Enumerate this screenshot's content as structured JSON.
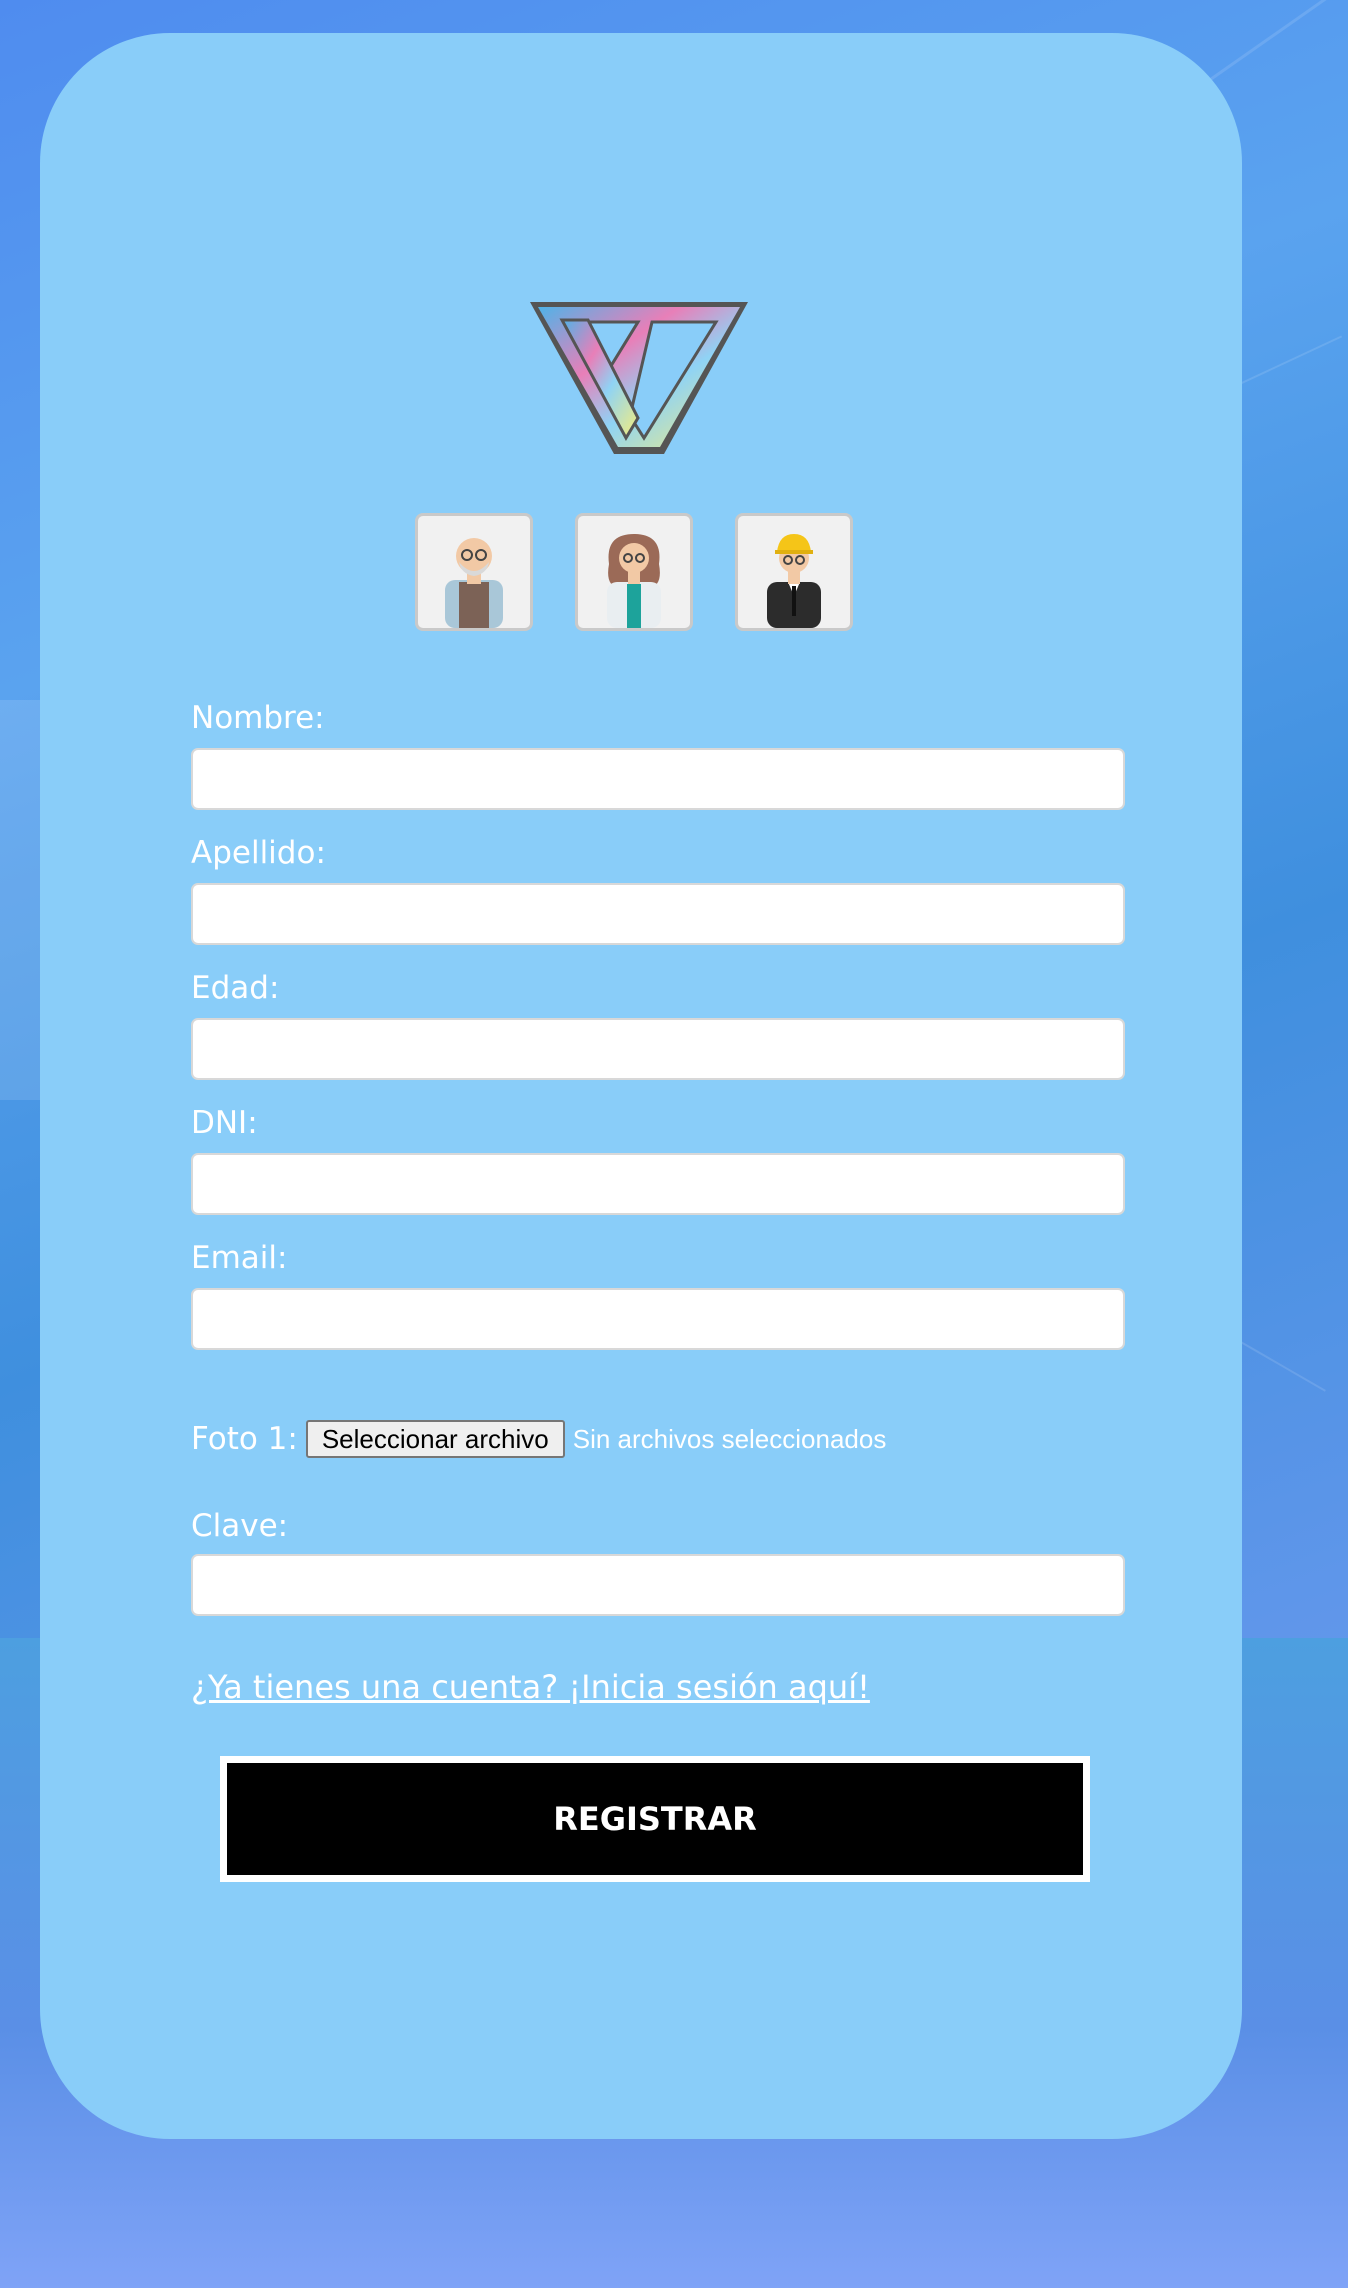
{
  "logo": {
    "name": "w-logo-icon"
  },
  "avatars": [
    {
      "name": "avatar-elderly-man-icon"
    },
    {
      "name": "avatar-doctor-woman-icon"
    },
    {
      "name": "avatar-engineer-man-icon"
    }
  ],
  "form": {
    "nombre_label": "Nombre:",
    "apellido_label": "Apellido:",
    "edad_label": "Edad:",
    "dni_label": "DNI:",
    "email_label": "Email:",
    "foto_label": "Foto 1:",
    "file_button_label": "Seleccionar archivo",
    "file_status": "Sin archivos seleccionados",
    "clave_label": "Clave:",
    "nombre_value": "",
    "apellido_value": "",
    "edad_value": "",
    "dni_value": "",
    "email_value": "",
    "clave_value": ""
  },
  "login_link": "¿Ya tienes una cuenta? ¡Inicia sesión aquí!",
  "submit_label": "REGISTRAR",
  "colors": {
    "card": "#89cdf9",
    "button": "#000000",
    "text": "#ffffff"
  }
}
